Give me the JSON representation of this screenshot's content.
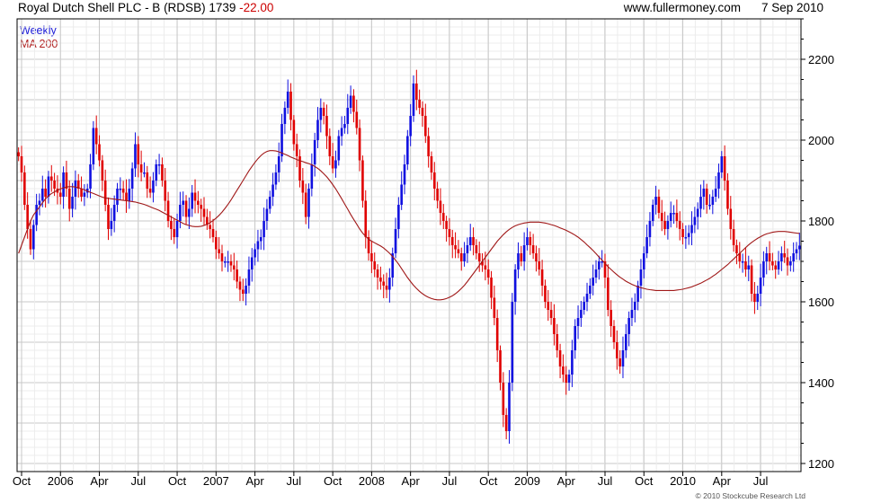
{
  "header": {
    "title_main": "Royal Dutch Shell PLC - B (RDSB) 1739",
    "title_change": "-22.00",
    "site": "www.fullermoney.com",
    "date": "7 Sep 2010"
  },
  "legend": {
    "series1": "Weekly",
    "series2": "MA 200"
  },
  "footer": {
    "copyright": "© 2010 Stockcube Research Ltd"
  },
  "colors": {
    "up": "#1010e0",
    "down": "#e00000",
    "ma": "#a01818",
    "grid": "#d8d8d8",
    "axis": "#000000"
  },
  "chart_data": {
    "type": "candlestick",
    "ylim": [
      1180,
      2300
    ],
    "yticks": [
      1200,
      1400,
      1600,
      1800,
      2000,
      2200
    ],
    "x_tick_labels": [
      "Oct",
      "2006",
      "Apr",
      "Jul",
      "Oct",
      "2007",
      "Apr",
      "Jul",
      "Oct",
      "2008",
      "Apr",
      "Jul",
      "Oct",
      "2009",
      "Apr",
      "Jul",
      "Oct",
      "2010",
      "Apr",
      "Jul"
    ],
    "x_tick_weeks": [
      1,
      14,
      27,
      40,
      53,
      66,
      79,
      92,
      105,
      118,
      131,
      144,
      157,
      170,
      183,
      196,
      209,
      222,
      235,
      248
    ],
    "total_weeks": 262,
    "weekly_close": [
      1960,
      1920,
      1840,
      1780,
      1730,
      1790,
      1840,
      1850,
      1880,
      1860,
      1910,
      1900,
      1880,
      1870,
      1860,
      1920,
      1880,
      1830,
      1860,
      1900,
      1880,
      1860,
      1870,
      1880,
      1940,
      2030,
      1990,
      1950,
      1900,
      1840,
      1780,
      1800,
      1840,
      1880,
      1880,
      1870,
      1850,
      1880,
      1930,
      1990,
      1940,
      1920,
      1920,
      1880,
      1870,
      1900,
      1940,
      1940,
      1900,
      1850,
      1800,
      1780,
      1760,
      1800,
      1840,
      1850,
      1810,
      1830,
      1870,
      1850,
      1840,
      1830,
      1810,
      1790,
      1780,
      1760,
      1730,
      1720,
      1700,
      1700,
      1700,
      1690,
      1680,
      1650,
      1630,
      1620,
      1640,
      1680,
      1710,
      1730,
      1750,
      1760,
      1800,
      1830,
      1860,
      1890,
      1920,
      1960,
      2040,
      2080,
      2120,
      2050,
      1990,
      1960,
      1900,
      1870,
      1810,
      1880,
      1940,
      2000,
      2050,
      2080,
      2060,
      2010,
      1960,
      1930,
      1950,
      2010,
      2030,
      2040,
      2080,
      2110,
      2070,
      2030,
      1950,
      1850,
      1760,
      1720,
      1700,
      1680,
      1660,
      1650,
      1640,
      1630,
      1660,
      1720,
      1780,
      1840,
      1890,
      1940,
      2010,
      2060,
      2140,
      2100,
      2080,
      2060,
      2010,
      1960,
      1920,
      1880,
      1850,
      1820,
      1800,
      1780,
      1760,
      1740,
      1730,
      1720,
      1700,
      1720,
      1740,
      1760,
      1740,
      1720,
      1700,
      1690,
      1680,
      1660,
      1610,
      1560,
      1480,
      1400,
      1320,
      1280,
      1400,
      1600,
      1680,
      1720,
      1700,
      1740,
      1760,
      1740,
      1720,
      1700,
      1680,
      1640,
      1600,
      1580,
      1560,
      1520,
      1480,
      1440,
      1420,
      1400,
      1420,
      1480,
      1540,
      1560,
      1580,
      1600,
      1620,
      1640,
      1660,
      1680,
      1700,
      1700,
      1660,
      1580,
      1540,
      1500,
      1460,
      1440,
      1480,
      1520,
      1560,
      1580,
      1600,
      1640,
      1680,
      1720,
      1760,
      1800,
      1840,
      1860,
      1820,
      1800,
      1780,
      1800,
      1820,
      1820,
      1800,
      1780,
      1760,
      1760,
      1770,
      1790,
      1810,
      1830,
      1860,
      1880,
      1840,
      1840,
      1860,
      1880,
      1920,
      1960,
      1900,
      1830,
      1780,
      1740,
      1720,
      1700,
      1700,
      1680,
      1690,
      1620,
      1600,
      1620,
      1660,
      1700,
      1720,
      1700,
      1690,
      1680,
      1700,
      1720,
      1710,
      1690,
      1700,
      1720,
      1730,
      1739
    ],
    "ma200": [
      1720,
      1740,
      1760,
      1780,
      1800,
      1815,
      1825,
      1835,
      1845,
      1855,
      1862,
      1868,
      1872,
      1876,
      1879,
      1882,
      1884,
      1885,
      1885,
      1884,
      1882,
      1880,
      1877,
      1874,
      1871,
      1868,
      1865,
      1862,
      1859,
      1857,
      1856,
      1855,
      1854,
      1853,
      1852,
      1851,
      1850,
      1849,
      1848,
      1847,
      1845,
      1843,
      1841,
      1838,
      1835,
      1832,
      1829,
      1826,
      1822,
      1818,
      1814,
      1810,
      1806,
      1802,
      1798,
      1794,
      1791,
      1789,
      1787,
      1786,
      1786,
      1787,
      1789,
      1792,
      1796,
      1801,
      1807,
      1814,
      1822,
      1831,
      1841,
      1852,
      1864,
      1876,
      1888,
      1900,
      1912,
      1924,
      1935,
      1945,
      1954,
      1962,
      1968,
      1972,
      1974,
      1974,
      1973,
      1971,
      1968,
      1965,
      1962,
      1958,
      1955,
      1952,
      1949,
      1947,
      1944,
      1942,
      1939,
      1935,
      1930,
      1924,
      1917,
      1909,
      1900,
      1890,
      1879,
      1867,
      1855,
      1842,
      1829,
      1816,
      1804,
      1792,
      1780,
      1770,
      1762,
      1755,
      1750,
      1746,
      1742,
      1738,
      1733,
      1727,
      1720,
      1712,
      1703,
      1693,
      1682,
      1671,
      1660,
      1650,
      1641,
      1633,
      1626,
      1620,
      1615,
      1611,
      1608,
      1606,
      1605,
      1605,
      1606,
      1608,
      1611,
      1615,
      1620,
      1626,
      1633,
      1641,
      1650,
      1660,
      1670,
      1680,
      1690,
      1700,
      1710,
      1720,
      1730,
      1740,
      1750,
      1758,
      1766,
      1773,
      1779,
      1784,
      1788,
      1791,
      1793,
      1795,
      1796,
      1797,
      1797,
      1797,
      1797,
      1796,
      1795,
      1793,
      1791,
      1789,
      1786,
      1783,
      1780,
      1777,
      1773,
      1769,
      1765,
      1760,
      1754,
      1748,
      1741,
      1734,
      1727,
      1719,
      1711,
      1703,
      1695,
      1687,
      1680,
      1673,
      1667,
      1661,
      1656,
      1651,
      1647,
      1643,
      1640,
      1637,
      1635,
      1633,
      1631,
      1630,
      1629,
      1628,
      1628,
      1628,
      1628,
      1628,
      1628,
      1628,
      1629,
      1630,
      1631,
      1633,
      1635,
      1637,
      1640,
      1643,
      1646,
      1650,
      1654,
      1658,
      1663,
      1668,
      1674,
      1680,
      1686,
      1692,
      1699,
      1706,
      1713,
      1720,
      1727,
      1734,
      1741,
      1747,
      1752,
      1757,
      1761,
      1765,
      1768,
      1770,
      1772,
      1773,
      1774,
      1774,
      1774,
      1773,
      1772,
      1771,
      1770,
      1769
    ]
  }
}
